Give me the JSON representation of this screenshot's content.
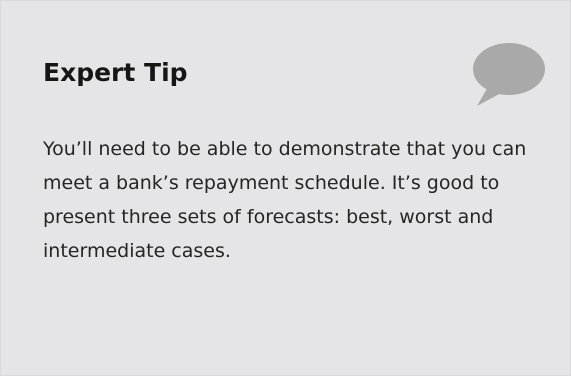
{
  "tip": {
    "title": "Expert Tip",
    "body": "You’ll need to be able to demonstrate that you can meet a bank’s repayment schedule. It’s good to present three sets of forecasts: best, worst and intermediate cases.",
    "icon": "speech-bubble-icon",
    "colors": {
      "background": "#e5e5e7",
      "icon": "#a9a9a9",
      "title": "#161616",
      "text": "#252525"
    }
  }
}
